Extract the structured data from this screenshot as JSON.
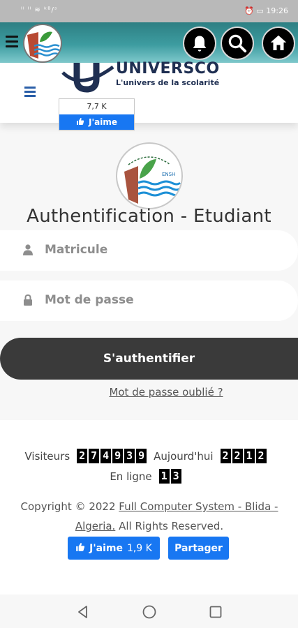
{
  "status_bar": {
    "left_text": "ᴵˡ ᴵˡ ≋ ᵏᴮ/ˢ",
    "time": "19:26"
  },
  "app_toolbar": {
    "menu_icon": "hamburger-icon",
    "actions": [
      "bell-icon",
      "search-icon",
      "home-icon"
    ]
  },
  "site_header": {
    "brand_name": "UNIVERSCO",
    "tagline": "L'univers de la scolarité",
    "like_count": "7,7 K",
    "like_label": "J'aime"
  },
  "login": {
    "title": "Authentification - Etudiant",
    "matricule_placeholder": "Matricule",
    "password_placeholder": "Mot de passe",
    "submit_label": "S'authentifier",
    "forgot_label": "Mot de passe oublié ?"
  },
  "logo": {
    "text": "ENSH"
  },
  "stats": {
    "visitors_label": "Visiteurs",
    "visitors_digits": [
      "2",
      "7",
      "4",
      "9",
      "3",
      "9"
    ],
    "today_label": "Aujourd'hui",
    "today_digits": [
      "2",
      "2",
      "1",
      "2"
    ],
    "online_label": "En ligne",
    "online_digits": [
      "1",
      "3"
    ]
  },
  "footer": {
    "copyright_prefix": "Copyright © 2022 ",
    "company_link": "Full Computer System - Blida - Algeria.",
    "rights": " All Rights Reserved.",
    "fb_like_label": "J'aime",
    "fb_like_count": "1,9 K",
    "fb_share_label": "Partager"
  },
  "colors": {
    "toolbar": "#3d9ca0",
    "facebook": "#1877f2",
    "button_dark": "#3a3a3a"
  }
}
